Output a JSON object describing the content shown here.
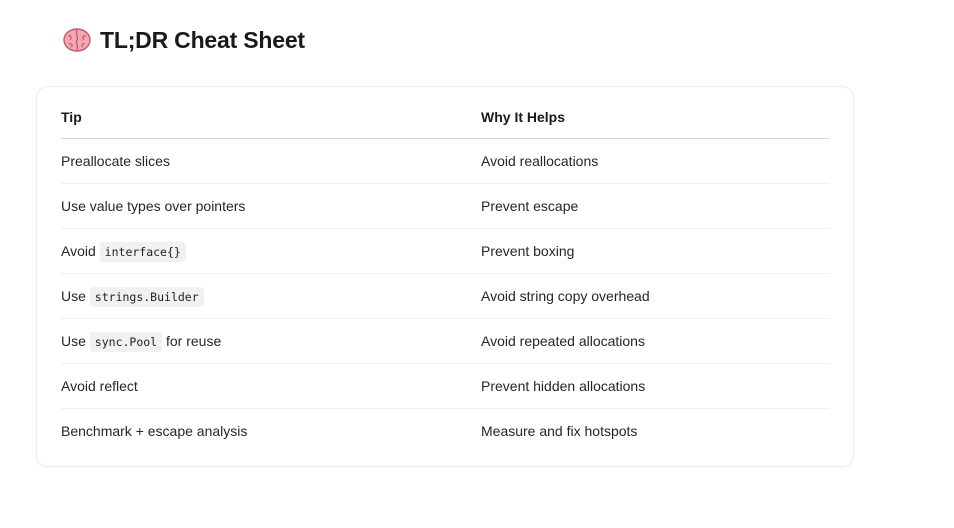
{
  "header": {
    "icon": "brain-icon",
    "title": "TL;DR Cheat Sheet"
  },
  "table": {
    "columns": [
      "Tip",
      "Why It Helps"
    ],
    "rows": [
      {
        "tip": [
          {
            "text": "Preallocate slices"
          }
        ],
        "why": "Avoid reallocations"
      },
      {
        "tip": [
          {
            "text": "Use value types over pointers"
          }
        ],
        "why": "Prevent escape"
      },
      {
        "tip": [
          {
            "text": "Avoid "
          },
          {
            "code": "interface{}"
          }
        ],
        "why": "Prevent boxing"
      },
      {
        "tip": [
          {
            "text": "Use "
          },
          {
            "code": "strings.Builder"
          }
        ],
        "why": "Avoid string copy overhead"
      },
      {
        "tip": [
          {
            "text": "Use "
          },
          {
            "code": "sync.Pool"
          },
          {
            "text": " for reuse"
          }
        ],
        "why": "Avoid repeated allocations"
      },
      {
        "tip": [
          {
            "text": "Avoid reflect"
          }
        ],
        "why": "Prevent hidden allocations"
      },
      {
        "tip": [
          {
            "text": "Benchmark + escape analysis"
          }
        ],
        "why": "Measure and fix hotspots"
      }
    ]
  }
}
